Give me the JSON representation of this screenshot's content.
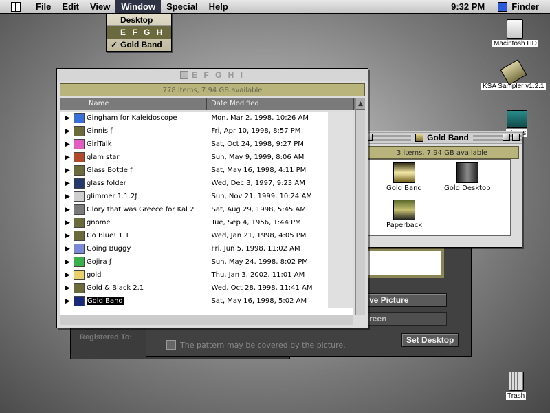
{
  "menubar": {
    "items": [
      "File",
      "Edit",
      "View",
      "Window",
      "Special",
      "Help"
    ],
    "active_item": "Window",
    "clock": "9:32 PM",
    "app_name": "Finder"
  },
  "window_menu": {
    "items": [
      {
        "label": "Desktop",
        "checked": false,
        "highlighted": false
      },
      {
        "label": "E F G H I",
        "checked": false,
        "highlighted": true
      },
      {
        "label": "Gold Band",
        "checked": true,
        "highlighted": false
      }
    ]
  },
  "desktop_icons": {
    "hd": "Macintosh HD",
    "ksa": "KSA Sampler v1.2.1",
    "pictures": "ctures",
    "trash": "Trash"
  },
  "efghi_window": {
    "title": "E F G H I",
    "info": "778 items, 7.94 GB available",
    "columns": {
      "name": "Name",
      "date": "Date Modified"
    },
    "rows": [
      {
        "name": "Gingham for Kaleidoscope",
        "date": "Mon, Mar 2, 1998, 10:26 AM",
        "icon_color": "#3a6fd8",
        "selected": false
      },
      {
        "name": "Ginnis ƒ",
        "date": "Fri, Apr 10, 1998, 8:57 PM",
        "icon_color": "#6a6a3a",
        "selected": false
      },
      {
        "name": "GirlTalk",
        "date": "Sat, Oct 24, 1998, 9:27 PM",
        "icon_color": "#e05fc0",
        "selected": false
      },
      {
        "name": "glam star",
        "date": "Sun, May 9, 1999, 8:06 AM",
        "icon_color": "#b04a2a",
        "selected": false
      },
      {
        "name": "Glass Bottle ƒ",
        "date": "Sat, May 16, 1998, 4:11 PM",
        "icon_color": "#6a6a3a",
        "selected": false
      },
      {
        "name": "glass folder",
        "date": "Wed, Dec 3, 1997, 9:23 AM",
        "icon_color": "#223a6a",
        "selected": false
      },
      {
        "name": "glimmer 1.1.2ƒ",
        "date": "Sun, Nov 21, 1999, 10:24 AM",
        "icon_color": "#cfcfcf",
        "selected": false
      },
      {
        "name": "Glory that was Greece for Kal 2",
        "date": "Sat, Aug 29, 1998, 5:45 AM",
        "icon_color": "#7a7a7a",
        "selected": false
      },
      {
        "name": "gnome",
        "date": "Tue, Sep 4, 1956, 1:44 PM",
        "icon_color": "#6a6a3a",
        "selected": false
      },
      {
        "name": "Go Blue! 1.1",
        "date": "Wed, Jan 21, 1998, 4:05 PM",
        "icon_color": "#6a6a3a",
        "selected": false
      },
      {
        "name": "Going Buggy",
        "date": "Fri, Jun 5, 1998, 11:02 AM",
        "icon_color": "#7a8ad8",
        "selected": false
      },
      {
        "name": "Gojira ƒ",
        "date": "Sun, May 24, 1998, 8:02 PM",
        "icon_color": "#3ab04a",
        "selected": false
      },
      {
        "name": "gold",
        "date": "Thu, Jan 3, 2002, 11:01 AM",
        "icon_color": "#e8d06a",
        "selected": false
      },
      {
        "name": "Gold & Black 2.1",
        "date": "Wed, Oct 28, 1998, 11:41 AM",
        "icon_color": "#6a6a3a",
        "selected": false
      },
      {
        "name": "Gold Band",
        "date": "Sat, May 16, 1998, 5:02 AM",
        "icon_color": "#1a2a7a",
        "selected": true
      }
    ]
  },
  "goldband_window": {
    "title": "Gold Band",
    "info": "3 items, 7.94 GB available",
    "items": [
      "Gold Band",
      "Gold Desktop",
      "Paperback"
    ]
  },
  "control_panel": {
    "save_picture": "ve Picture",
    "screen": "reen",
    "set_desktop": "Set Desktop",
    "registered": "Registered To:",
    "note": "The pattern may be covered by the picture."
  }
}
